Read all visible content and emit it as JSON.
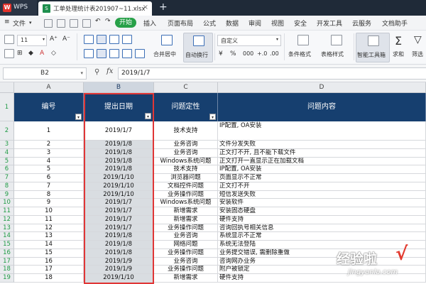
{
  "titlebar": {
    "app_label": "WPS",
    "doc_title": "工单处理统计表201907~11.xlsx",
    "close_glyph": "×",
    "new_tab_glyph": "+"
  },
  "menubar": {
    "file_label": "文件",
    "start_label": "开始",
    "items": [
      "插入",
      "页面布局",
      "公式",
      "数据",
      "审阅",
      "视图",
      "安全",
      "开发工具",
      "云服务",
      "文档助手"
    ]
  },
  "ribbon": {
    "font_size": "11",
    "number_format": "自定义",
    "merge_label": "合并居中",
    "wrap_label": "自动换行",
    "currency": "¥",
    "percent": "%",
    "cond_format_label": "条件格式",
    "table_style_label": "表格样式",
    "smart_toolbox_label": "智能工具箱",
    "sum_label": "求和",
    "filter_label": "筛选"
  },
  "formulabar": {
    "cell_ref": "B2",
    "fx": "fx",
    "content": "2019/1/7"
  },
  "grid": {
    "columns": [
      "A",
      "B",
      "C",
      "D"
    ],
    "header_row_number": "1",
    "headers": [
      "编号",
      "提出日期",
      "问题定性",
      "问题内容"
    ],
    "rows": [
      {
        "n": "2",
        "id": "1",
        "date": "2019/1/7",
        "type": "技术支持",
        "content": "IP配置, OA安装"
      },
      {
        "n": "3",
        "id": "2",
        "date": "2019/1/8",
        "type": "业务咨询",
        "content": "文件分发失败"
      },
      {
        "n": "4",
        "id": "3",
        "date": "2019/1/8",
        "type": "业务咨询",
        "content": "正文打不开, 且不能下载文件"
      },
      {
        "n": "5",
        "id": "4",
        "date": "2019/1/8",
        "type": "Windows系统问题",
        "content": "正文打开一直显示正在加载文档"
      },
      {
        "n": "6",
        "id": "5",
        "date": "2019/1/8",
        "type": "技术支持",
        "content": "IP配置, OA安装"
      },
      {
        "n": "7",
        "id": "6",
        "date": "2019/1/10",
        "type": "浏览器问题",
        "content": "页面显示不正常"
      },
      {
        "n": "8",
        "id": "7",
        "date": "2019/1/10",
        "type": "文档控件问题",
        "content": "正文打不开"
      },
      {
        "n": "9",
        "id": "8",
        "date": "2019/1/10",
        "type": "业务操作问题",
        "content": "短信发送失败"
      },
      {
        "n": "10",
        "id": "9",
        "date": "2019/1/7",
        "type": "Windows系统问题",
        "content": "安装软件"
      },
      {
        "n": "11",
        "id": "10",
        "date": "2019/1/7",
        "type": "新增需求",
        "content": "安装固态硬盘"
      },
      {
        "n": "12",
        "id": "11",
        "date": "2019/1/7",
        "type": "新增需求",
        "content": "硬件支持"
      },
      {
        "n": "13",
        "id": "12",
        "date": "2019/1/7",
        "type": "业务操作问题",
        "content": "咨询回执号相关信息"
      },
      {
        "n": "14",
        "id": "13",
        "date": "2019/1/8",
        "type": "业务咨询",
        "content": "系统显示不正常"
      },
      {
        "n": "15",
        "id": "14",
        "date": "2019/1/8",
        "type": "网络问题",
        "content": "系统无法登陆"
      },
      {
        "n": "16",
        "id": "15",
        "date": "2019/1/8",
        "type": "业务操作问题",
        "content": "业务提交错误, 需删除重做"
      },
      {
        "n": "17",
        "id": "16",
        "date": "2019/1/9",
        "type": "业务咨询",
        "content": "咨询网办业务"
      },
      {
        "n": "18",
        "id": "17",
        "date": "2019/1/9",
        "type": "业务操作问题",
        "content": "附户被锁定"
      },
      {
        "n": "19",
        "id": "18",
        "date": "2019/1/10",
        "type": "新增需求",
        "content": "硬件支持"
      }
    ]
  },
  "watermark": {
    "text": "经验啦",
    "check": "√",
    "url": "jingyanla.com"
  }
}
